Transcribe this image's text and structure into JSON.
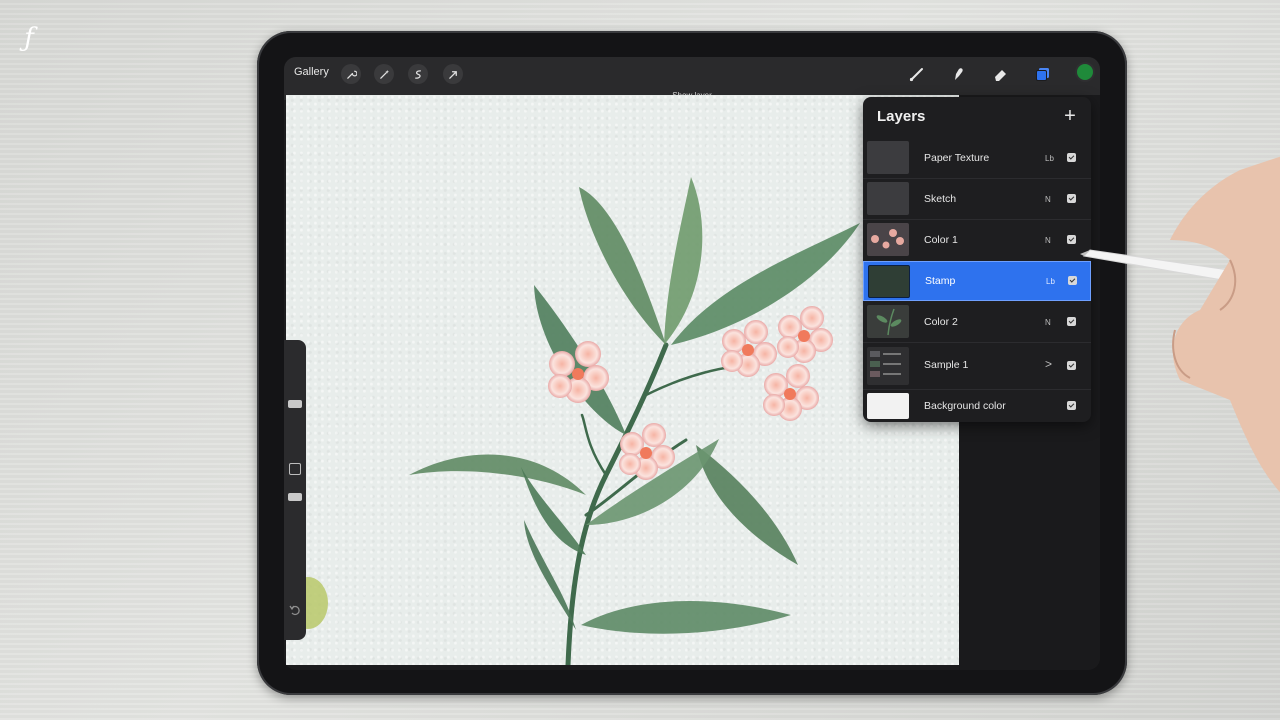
{
  "app": {
    "gallery_label": "Gallery",
    "notice": "Show layer"
  },
  "toolbar": {
    "left_tools": [
      "wrench-icon",
      "magic-wand-icon",
      "selection-icon",
      "transform-arrow-icon"
    ],
    "right_tools": [
      "brush-icon",
      "smudge-icon",
      "eraser-icon",
      "layers-icon"
    ],
    "active_tool": "layers-icon",
    "current_color": "#1f8a3a",
    "accent_color": "#2e72ee"
  },
  "layers_panel": {
    "title": "Layers",
    "add_symbol": "+",
    "layers": [
      {
        "name": "Paper Texture",
        "mode": "Lb",
        "visible": true,
        "selected": false,
        "thumb": "dark"
      },
      {
        "name": "Sketch",
        "mode": "N",
        "visible": true,
        "selected": false,
        "thumb": "dark"
      },
      {
        "name": "Color 1",
        "mode": "N",
        "visible": true,
        "selected": false,
        "thumb": "flowers"
      },
      {
        "name": "Stamp",
        "mode": "Lb",
        "visible": true,
        "selected": true,
        "thumb": "green"
      },
      {
        "name": "Color 2",
        "mode": "N",
        "visible": true,
        "selected": false,
        "thumb": "leaves"
      },
      {
        "name": "Sample 1",
        "mode": ">",
        "visible": true,
        "selected": false,
        "thumb": "group"
      },
      {
        "name": "Background color",
        "mode": "",
        "visible": true,
        "selected": false,
        "thumb": "white"
      }
    ]
  }
}
